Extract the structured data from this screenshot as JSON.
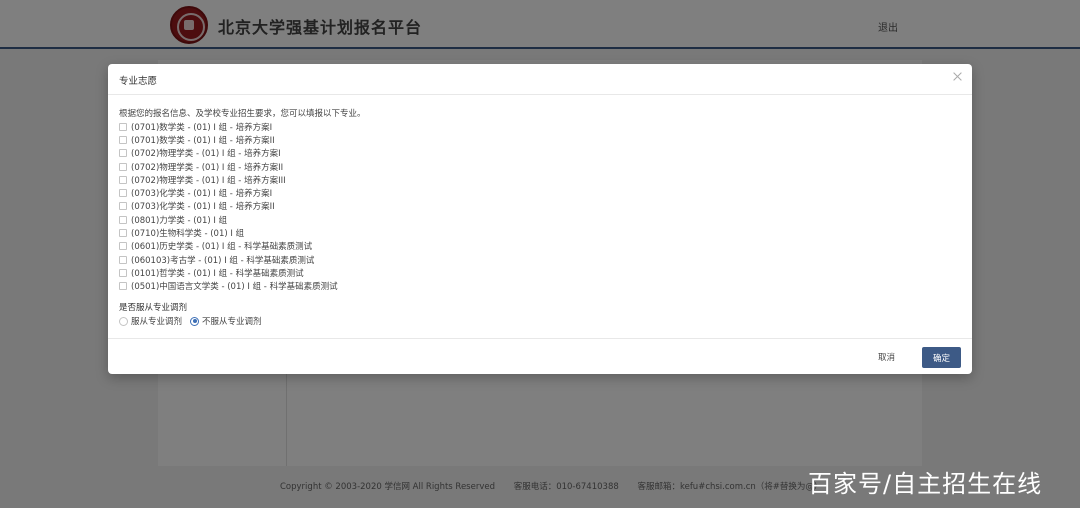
{
  "header": {
    "site_title": "北京大学强基计划报名平台",
    "logout": "退出"
  },
  "dialog": {
    "title": "专业志愿",
    "intro": "根据您的报名信息、及学校专业招生要求，您可以填报以下专业。",
    "options": [
      "(0701)数学类 - (01) I 组 - 培养方案I",
      "(0701)数学类 - (01) I 组 - 培养方案II",
      "(0702)物理学类 - (01) I 组 - 培养方案I",
      "(0702)物理学类 - (01) I 组 - 培养方案II",
      "(0702)物理学类 - (01) I 组 - 培养方案III",
      "(0703)化学类 - (01) I 组 - 培养方案I",
      "(0703)化学类 - (01) I 组 - 培养方案II",
      "(0801)力学类 - (01) I 组",
      "(0710)生物科学类 - (01) I 组",
      "(0601)历史学类 - (01) I 组 - 科学基础素质测试",
      "(060103)考古学 - (01) I 组 - 科学基础素质测试",
      "(0101)哲学类 - (01) I 组 - 科学基础素质测试",
      "(0501)中国语言文学类 - (01) I 组 - 科学基础素质测试"
    ],
    "adjust_title": "是否服从专业调剂",
    "adjust_options": [
      "服从专业调剂",
      "不服从专业调剂"
    ],
    "adjust_selected": "不服从专业调剂",
    "cancel_label": "取消",
    "ok_label": "确定"
  },
  "footer": {
    "copyright": "Copyright © 2003-2020 学信网 All Rights Reserved",
    "phone": "客服电话：010-67410388",
    "email": "客服邮箱：kefu#chsi.com.cn（将#替换为@）"
  },
  "watermark": "百家号/自主招生在线",
  "colors": {
    "brand": "#3d5a86",
    "radio_checked": "#3d6fb6",
    "logo": "#9b1b1e"
  }
}
